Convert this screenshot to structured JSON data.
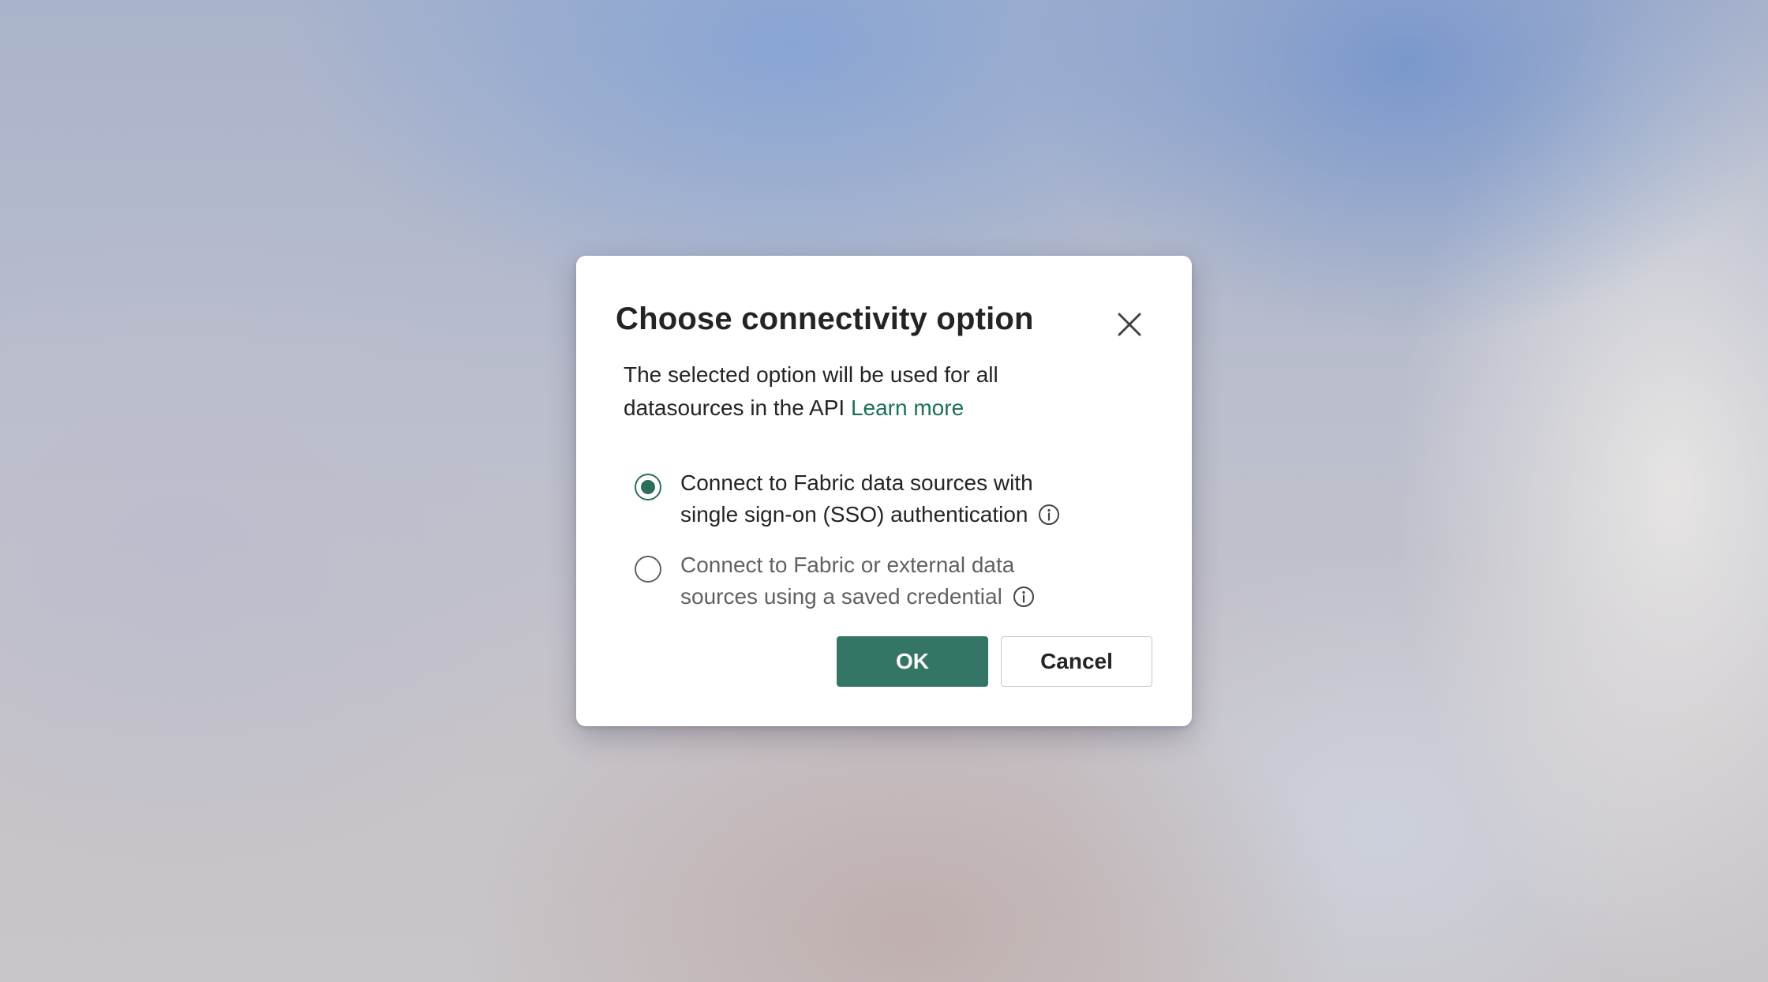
{
  "dialog": {
    "title": "Choose connectivity option",
    "description": "The selected option will be used for all datasources in the API",
    "learn_more": "Learn more",
    "options": [
      {
        "label": "Connect to Fabric data sources with single sign-on (SSO) authentication",
        "selected": true
      },
      {
        "label": "Connect to Fabric or external data sources using a saved credential",
        "selected": false
      }
    ],
    "ok_label": "OK",
    "cancel_label": "Cancel"
  },
  "colors": {
    "accent": "#357565",
    "link": "#1b6e58",
    "text": "#242424"
  },
  "icons": {
    "close": "close-icon",
    "info": "info-icon"
  }
}
